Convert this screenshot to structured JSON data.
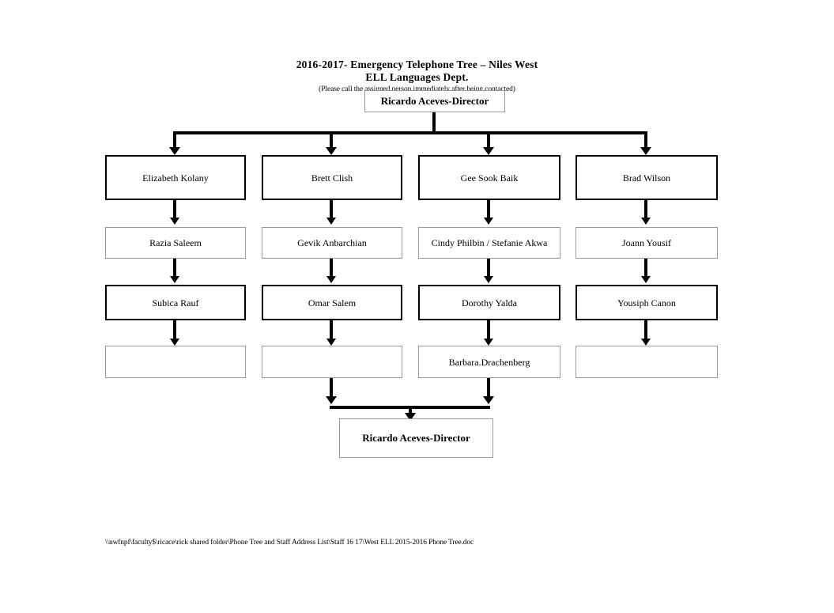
{
  "document": {
    "title_line_1": "2016-2017- Emergency Telephone Tree – Niles West",
    "title_line_2": "ELL Languages Dept.",
    "subtitle": "(Please call the assigned person immediately after being contacted)",
    "footer_path": "\\\\nwfnpf\\faculty$\\ricace\\rick shared folder\\Phone Tree and Staff Address List\\Staff  16  17\\West ELL 2015-2016 Phone Tree.doc"
  },
  "chart_data": {
    "type": "diagram",
    "title": "2016-2017- Emergency Telephone Tree – Niles West ELL Languages Dept.",
    "root": "Ricardo Aceves-Director",
    "terminal": "Ricardo Aceves-Director",
    "columns": [
      {
        "name": "column-1",
        "nodes": [
          "Elizabeth Kolany",
          "Razia Saleem",
          "Subica Rauf",
          ""
        ]
      },
      {
        "name": "column-2",
        "nodes": [
          "Brett Clish",
          "Gevik Anbarchian",
          "Omar Salem",
          ""
        ]
      },
      {
        "name": "column-3",
        "nodes": [
          "Gee Sook Baik",
          "Cindy Philbin / Stefanie Akwa",
          "Dorothy Yalda",
          "Barbara.Drachenberg"
        ]
      },
      {
        "name": "column-4",
        "nodes": [
          "Brad Wilson",
          "Joann Yousif",
          "Yousiph Canon",
          ""
        ]
      }
    ]
  },
  "nodes": {
    "top": "Ricardo Aceves-Director",
    "r1c1": "Elizabeth Kolany",
    "r1c2": "Brett Clish",
    "r1c3": "Gee Sook Baik",
    "r1c4": "Brad Wilson",
    "r2c1": "Razia Saleem",
    "r2c2": "Gevik Anbarchian",
    "r2c3": "Cindy Philbin / Stefanie Akwa",
    "r2c4": "Joann Yousif",
    "r3c1": "Subica Rauf",
    "r3c2": "Omar Salem",
    "r3c3": "Dorothy Yalda",
    "r3c4": "Yousiph Canon",
    "r4c1": "",
    "r4c2": "",
    "r4c3": "Barbara.Drachenberg",
    "r4c4": "",
    "bottom": "Ricardo Aceves-Director"
  },
  "colors": {
    "ink": "#000000",
    "thin_border": "#9a9a9a",
    "background": "#ffffff"
  }
}
